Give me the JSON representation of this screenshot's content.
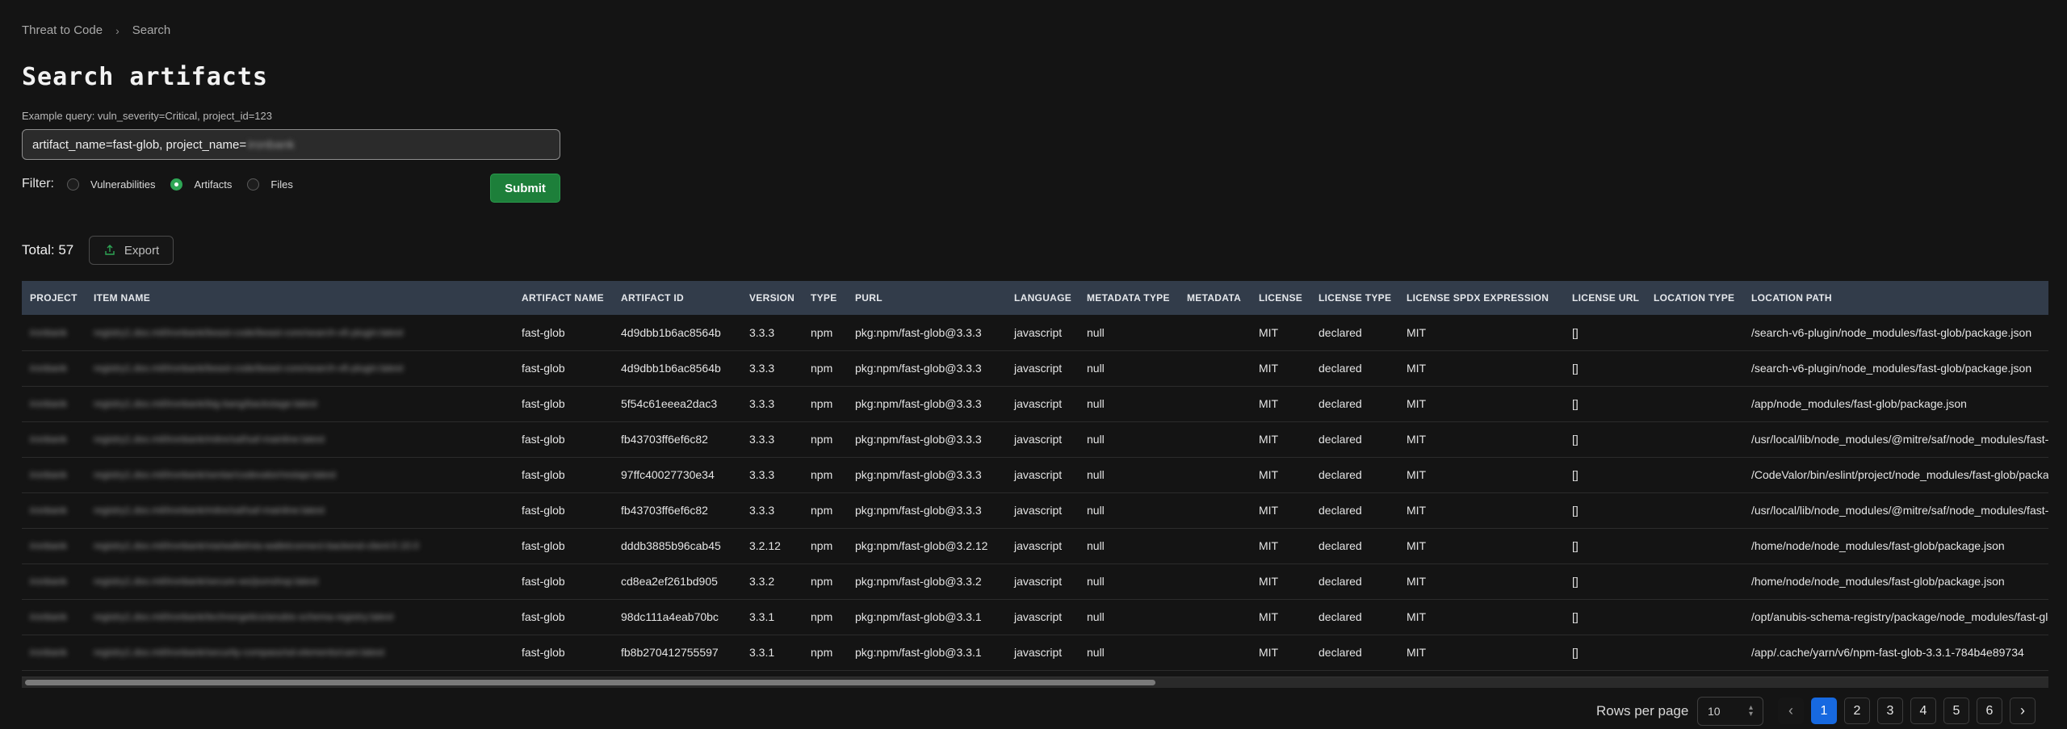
{
  "breadcrumb": {
    "root": "Threat to Code",
    "current": "Search"
  },
  "title": "Search artifacts",
  "hint": "Example query: vuln_severity=Critical, project_id=123",
  "search": {
    "value_visible": "artifact_name=fast-glob, project_name=",
    "value_redacted": "ironbank"
  },
  "filter": {
    "label": "Filter:",
    "options": [
      {
        "label": "Vulnerabilities",
        "checked": false
      },
      {
        "label": "Artifacts",
        "checked": true
      },
      {
        "label": "Files",
        "checked": false
      }
    ]
  },
  "submit_label": "Submit",
  "total_label": "Total: 57",
  "export_label": "Export",
  "table": {
    "headers": [
      "PROJECT",
      "ITEM NAME",
      "ARTIFACT NAME",
      "ARTIFACT ID",
      "VERSION",
      "TYPE",
      "PURL",
      "LANGUAGE",
      "METADATA TYPE",
      "METADATA",
      "LICENSE",
      "LICENSE TYPE",
      "LICENSE SPDX EXPRESSION",
      "LICENSE URL",
      "LOCATION TYPE",
      "LOCATION PATH"
    ],
    "rows": [
      [
        "ironbank",
        "registry1.dso.mil/ironbank/beast-code/beast-core/search-v6-plugin:latest",
        "fast-glob",
        "4d9dbb1b6ac8564b",
        "3.3.3",
        "npm",
        "pkg:npm/fast-glob@3.3.3",
        "javascript",
        "null",
        "",
        "MIT",
        "declared",
        "MIT",
        "[]",
        "",
        "/search-v6-plugin/node_modules/fast-glob/package.json"
      ],
      [
        "ironbank",
        "registry1.dso.mil/ironbank/beast-code/beast-core/search-v6-plugin:latest",
        "fast-glob",
        "4d9dbb1b6ac8564b",
        "3.3.3",
        "npm",
        "pkg:npm/fast-glob@3.3.3",
        "javascript",
        "null",
        "",
        "MIT",
        "declared",
        "MIT",
        "[]",
        "",
        "/search-v6-plugin/node_modules/fast-glob/package.json"
      ],
      [
        "ironbank",
        "registry1.dso.mil/ironbank/big-bang/backstage:latest",
        "fast-glob",
        "5f54c61eeea2dac3",
        "3.3.3",
        "npm",
        "pkg:npm/fast-glob@3.3.3",
        "javascript",
        "null",
        "",
        "MIT",
        "declared",
        "MIT",
        "[]",
        "",
        "/app/node_modules/fast-glob/package.json"
      ],
      [
        "ironbank",
        "registry1.dso.mil/ironbank/mitre/saf/saf-mainline:latest",
        "fast-glob",
        "fb43703ff6ef6c82",
        "3.3.3",
        "npm",
        "pkg:npm/fast-glob@3.3.3",
        "javascript",
        "null",
        "",
        "MIT",
        "declared",
        "MIT",
        "[]",
        "",
        "/usr/local/lib/node_modules/@mitre/saf/node_modules/fast-glob/package.json"
      ],
      [
        "ironbank",
        "registry1.dso.mil/ironbank/sentar/codevalor/restapi:latest",
        "fast-glob",
        "97ffc40027730e34",
        "3.3.3",
        "npm",
        "pkg:npm/fast-glob@3.3.3",
        "javascript",
        "null",
        "",
        "MIT",
        "declared",
        "MIT",
        "[]",
        "",
        "/CodeValor/bin/eslint/project/node_modules/fast-glob/package.json"
      ],
      [
        "ironbank",
        "registry1.dso.mil/ironbank/mitre/saf/saf-mainline:latest",
        "fast-glob",
        "fb43703ff6ef6c82",
        "3.3.3",
        "npm",
        "pkg:npm/fast-glob@3.3.3",
        "javascript",
        "null",
        "",
        "MIT",
        "declared",
        "MIT",
        "[]",
        "",
        "/usr/local/lib/node_modules/@mitre/saf/node_modules/fast-glob/package.json"
      ],
      [
        "ironbank",
        "registry1.dso.mil/ironbank/via/wallet/via-walletconnect-backend-client:0.10.0",
        "fast-glob",
        "dddb3885b96cab45",
        "3.2.12",
        "npm",
        "pkg:npm/fast-glob@3.2.12",
        "javascript",
        "null",
        "",
        "MIT",
        "declared",
        "MIT",
        "[]",
        "",
        "/home/node/node_modules/fast-glob/package.json"
      ],
      [
        "ironbank",
        "registry1.dso.mil/ironbank/secure-ws/jsonshop:latest",
        "fast-glob",
        "cd8ea2ef261bd905",
        "3.3.2",
        "npm",
        "pkg:npm/fast-glob@3.3.2",
        "javascript",
        "null",
        "",
        "MIT",
        "declared",
        "MIT",
        "[]",
        "",
        "/home/node/node_modules/fast-glob/package.json"
      ],
      [
        "ironbank",
        "registry1.dso.mil/ironbank/technergetics/anubis-schema-registry:latest",
        "fast-glob",
        "98dc111a4eab70bc",
        "3.3.1",
        "npm",
        "pkg:npm/fast-glob@3.3.1",
        "javascript",
        "null",
        "",
        "MIT",
        "declared",
        "MIT",
        "[]",
        "",
        "/opt/anubis-schema-registry/package/node_modules/fast-glob/package.json"
      ],
      [
        "ironbank",
        "registry1.dso.mil/ironbank/security-compass/sd-elements/cam:latest",
        "fast-glob",
        "fb8b270412755597",
        "3.3.1",
        "npm",
        "pkg:npm/fast-glob@3.3.1",
        "javascript",
        "null",
        "",
        "MIT",
        "declared",
        "MIT",
        "[]",
        "",
        "/app/.cache/yarn/v6/npm-fast-glob-3.3.1-784b4e89734"
      ]
    ]
  },
  "pagination": {
    "rows_per_page_label": "Rows per page",
    "rows_per_page_value": "10",
    "prev": "‹",
    "next": "›",
    "pages": [
      "1",
      "2",
      "3",
      "4",
      "5",
      "6"
    ],
    "current": "1"
  },
  "colors": {
    "accent": "#1769e0",
    "success": "#1d7f3a",
    "header_bg": "#323c4a"
  }
}
